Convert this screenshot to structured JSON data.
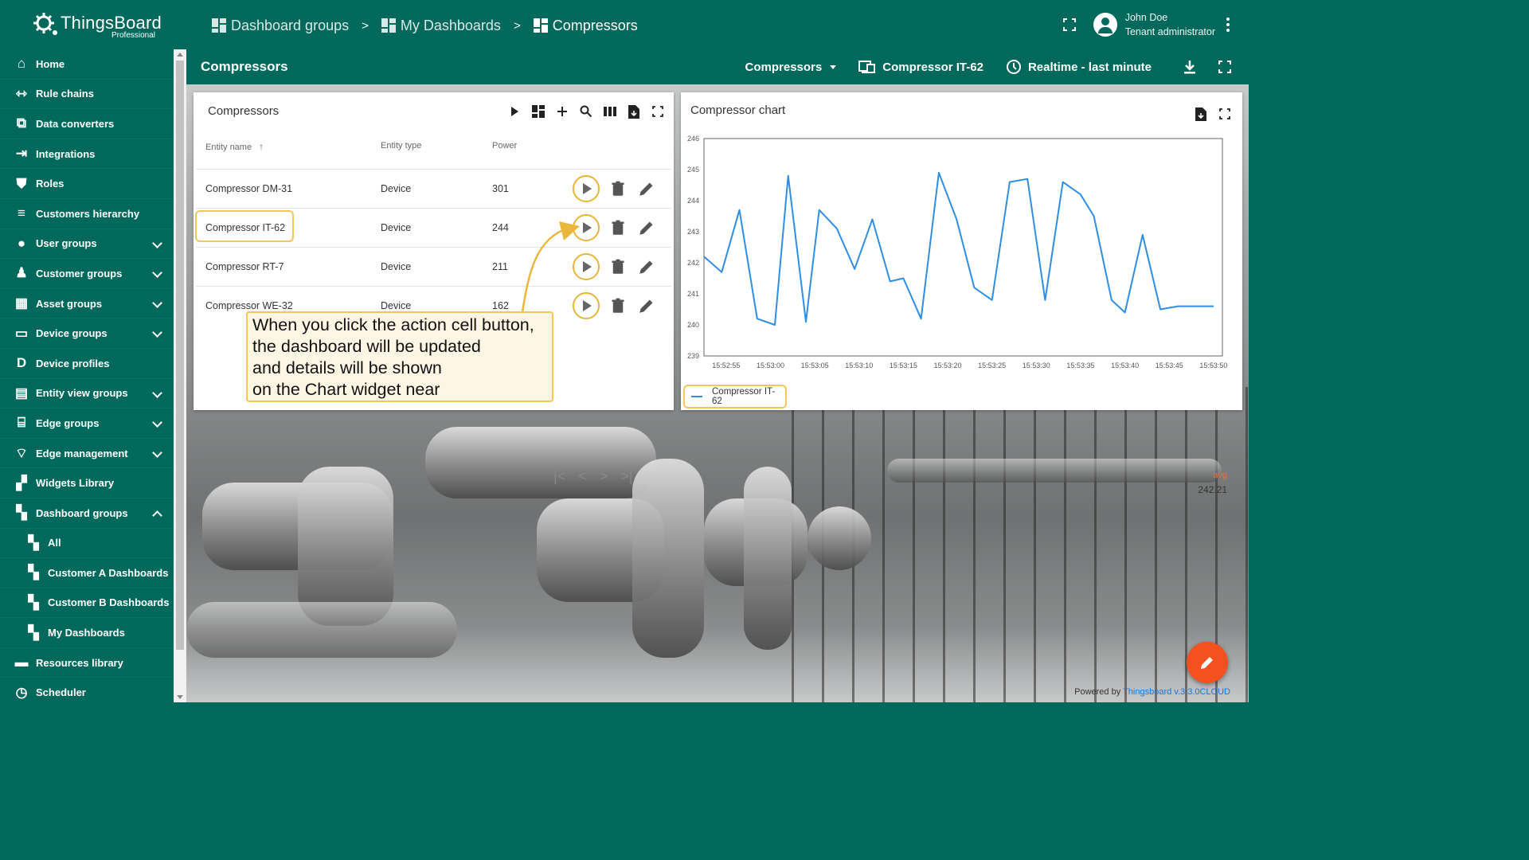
{
  "app": {
    "logo_name": "ThingsBoard",
    "logo_sub": "Professional"
  },
  "breadcrumbs": [
    "Dashboard groups",
    "My Dashboards",
    "Compressors"
  ],
  "breadcrumb_sep": ">",
  "user": {
    "name": "John Doe",
    "role": "Tenant administrator"
  },
  "sidebar": {
    "items": [
      {
        "label": "Home",
        "icon": "home-icon",
        "expand": false
      },
      {
        "label": "Rule chains",
        "icon": "rule-chains-icon",
        "expand": false
      },
      {
        "label": "Data converters",
        "icon": "converter-icon",
        "expand": false
      },
      {
        "label": "Integrations",
        "icon": "integrations-icon",
        "expand": false
      },
      {
        "label": "Roles",
        "icon": "shield-icon",
        "expand": false
      },
      {
        "label": "Customers hierarchy",
        "icon": "hierarchy-icon",
        "expand": false
      },
      {
        "label": "User groups",
        "icon": "account-icon",
        "expand": true
      },
      {
        "label": "Customer groups",
        "icon": "people-icon",
        "expand": true
      },
      {
        "label": "Asset groups",
        "icon": "domain-icon",
        "expand": true
      },
      {
        "label": "Device groups",
        "icon": "devices-icon",
        "expand": true
      },
      {
        "label": "Device profiles",
        "icon": "device-profile-icon",
        "expand": false
      },
      {
        "label": "Entity view groups",
        "icon": "view-quilt-icon",
        "expand": true
      },
      {
        "label": "Edge groups",
        "icon": "router-icon",
        "expand": true
      },
      {
        "label": "Edge management",
        "icon": "settings-input-antenna-icon",
        "expand": true
      },
      {
        "label": "Widgets Library",
        "icon": "widgets-icon",
        "expand": false
      },
      {
        "label": "Dashboard groups",
        "icon": "dashboard-icon",
        "expand": true,
        "open": true
      }
    ],
    "sub_items": [
      "All",
      "Customer A Dashboards",
      "Customer B Dashboards",
      "My Dashboards"
    ],
    "tail_items": [
      {
        "label": "Resources library",
        "icon": "folder-icon"
      },
      {
        "label": "Scheduler",
        "icon": "schedule-icon"
      }
    ]
  },
  "dashboard": {
    "title": "Compressors",
    "state_select": "Compressors",
    "entity": "Compressor IT-62",
    "timewindow": "Realtime - last minute"
  },
  "table_widget": {
    "title": "Compressors",
    "columns": [
      "Entity name",
      "Entity type",
      "Power"
    ],
    "rows": [
      {
        "name": "Compressor DM-31",
        "type": "Device",
        "power": "301"
      },
      {
        "name": "Compressor IT-62",
        "type": "Device",
        "power": "244"
      },
      {
        "name": "Compressor RT-7",
        "type": "Device",
        "power": "211"
      },
      {
        "name": "Compressor WE-32",
        "type": "Device",
        "power": "162"
      }
    ]
  },
  "callout": {
    "lines": [
      "When you click the action cell button,",
      "the  dashboard will be updated",
      "and details will be shown",
      "on the Chart widget near"
    ]
  },
  "chart_widget": {
    "title": "Compressor chart",
    "legend_label": "Compressor IT-62",
    "avg_label": "avg",
    "avg_value": "242.21",
    "series_color": "#2f8de4"
  },
  "chart_data": {
    "type": "line",
    "title": "",
    "xlabel": "",
    "ylabel": "",
    "ylim": [
      239,
      246
    ],
    "yticks": [
      239,
      240,
      241,
      242,
      243,
      244,
      245,
      246
    ],
    "xtick_labels": [
      "15:52:55",
      "15:53:00",
      "15:53:05",
      "15:53:10",
      "15:53:15",
      "15:53:20",
      "15:53:25",
      "15:53:30",
      "15:53:35",
      "15:53:40",
      "15:53:45",
      "15:53:50"
    ],
    "x_start_seconds": 52.5,
    "x_end_seconds": 111.0,
    "series": [
      {
        "name": "Compressor IT-62",
        "x": [
          52.5,
          54.5,
          56.5,
          58.5,
          60.5,
          62.0,
          64.0,
          65.5,
          67.5,
          69.5,
          71.5,
          73.5,
          75.0,
          77.0,
          79.0,
          81.0,
          83.0,
          85.0,
          87.0,
          89.0,
          91.0,
          93.0,
          95.0,
          96.5,
          98.5,
          100.0,
          102.0,
          104.0,
          106.0,
          108.0,
          110.0
        ],
        "y": [
          242.2,
          241.7,
          243.7,
          240.2,
          240.0,
          244.8,
          240.1,
          243.7,
          243.1,
          241.8,
          243.4,
          241.4,
          241.5,
          240.2,
          244.9,
          243.4,
          241.2,
          240.8,
          244.6,
          244.7,
          240.8,
          244.6,
          244.2,
          243.5,
          240.8,
          240.4,
          242.9,
          240.5,
          240.6,
          240.6,
          240.6
        ]
      }
    ],
    "grid": false,
    "legend": "bottom-left"
  },
  "pager": {
    "first": "|<",
    "prev": "<",
    "next": ">",
    "last": ">|"
  },
  "footer": {
    "powered_by": "Powered by",
    "link": "Thingsboard v.3.3.0CLOUD"
  },
  "colors": {
    "primary": "#00695c",
    "accent": "#f1c65c",
    "fab": "#f4511e",
    "series": "#2f8de4"
  }
}
